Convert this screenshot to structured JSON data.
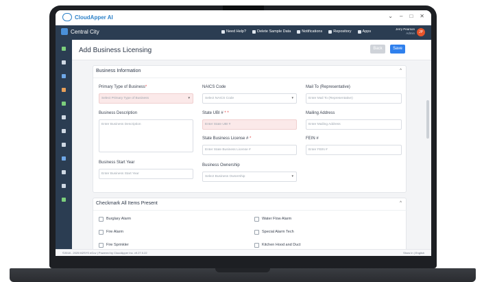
{
  "window": {
    "app_name": "CloudApper AI",
    "controls": [
      "⌄",
      "–",
      "□",
      "✕"
    ]
  },
  "topnav": {
    "city": "Central City",
    "links": [
      "Need Help?",
      "Delete Sample Data",
      "Notifications",
      "Repository",
      "Apps"
    ],
    "user_name": "Jerry Pearson",
    "user_role": "Admin",
    "avatar_initial": "JP"
  },
  "page": {
    "title": "Add Business Licensing",
    "back_label": "Back",
    "save_label": "Save"
  },
  "business_info": {
    "title": "Business Information",
    "primary_type_label": "Primary Type of Business",
    "primary_type_placeholder": "Select Primary Type of Business",
    "naics_label": "NAICS Code",
    "naics_placeholder": "Select NAICS Code",
    "mail_to_label": "Mail To (Representative)",
    "mail_to_placeholder": "Enter Mail To (Representative)",
    "description_label": "Business Description",
    "description_placeholder": "Enter Business Description",
    "state_ubi_label": "State UBI #",
    "state_ubi_placeholder": "Enter State UBI #",
    "mailing_address_label": "Mailing Address",
    "mailing_address_placeholder": "Enter Mailing Address",
    "state_license_label": "State Business License #",
    "state_license_placeholder": "Enter State Business License #",
    "fein_label": "FEIN #",
    "fein_placeholder": "Enter FEIN #",
    "start_year_label": "Business Start Year",
    "start_year_placeholder": "Enter Business Start Year",
    "ownership_label": "Business Ownership",
    "ownership_placeholder": "Select Business Ownership"
  },
  "checkmark": {
    "title": "Checkmark All Items Present",
    "left_items": [
      "Burglary Alarm",
      "Fire Alarm",
      "Fire Sprinkler"
    ],
    "right_items": [
      "Water Flow Alarm",
      "Special Alarm Tech",
      "Kitchen Hood and Duct"
    ]
  },
  "footer": {
    "left": "©2018 - 2025 M2SYS eGov | Powered by CloudApper Inc. v9.27.0.22",
    "right": "Show In | English"
  },
  "colors": {
    "nav_bg": "#2b3d52",
    "accent": "#2f80ed",
    "required": "#e53e3e"
  }
}
